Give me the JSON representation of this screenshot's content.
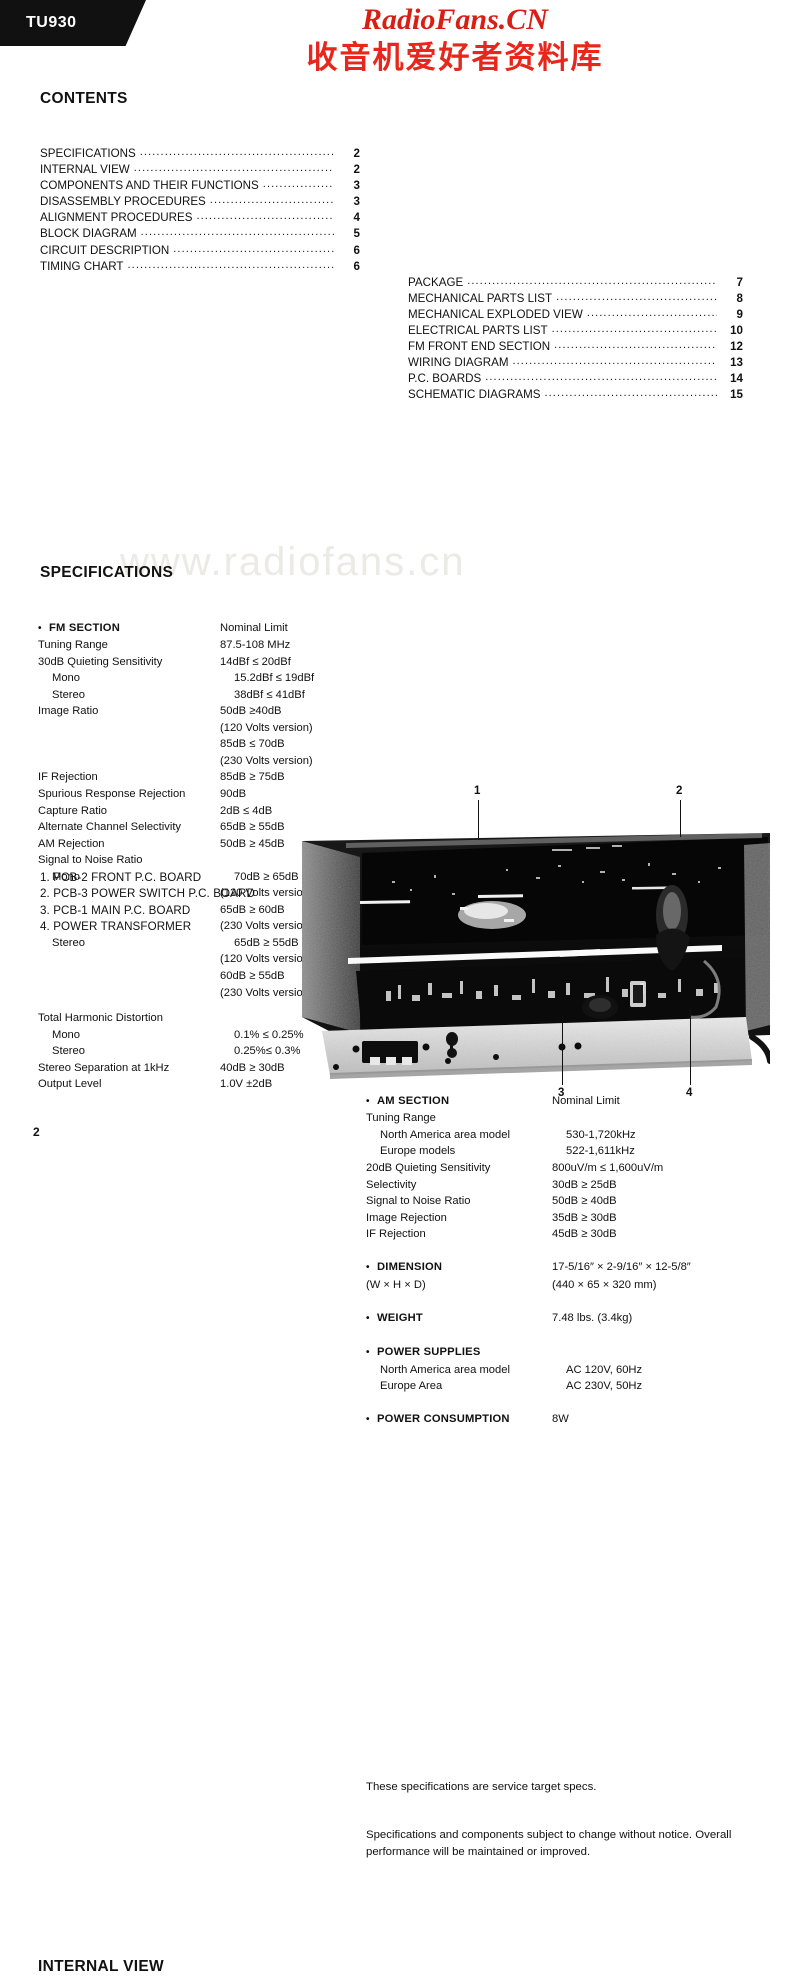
{
  "header": {
    "model": "TU930",
    "brand_latin": "RadioFans.CN",
    "brand_cjk": "收音机爱好者资料库",
    "brand_color": "#d81f16"
  },
  "watermark": "www.radiofans.cn",
  "page_number": "2",
  "contents": {
    "heading": "CONTENTS",
    "left": [
      {
        "label": "SPECIFICATIONS",
        "page": "2"
      },
      {
        "label": "INTERNAL VIEW",
        "page": "2"
      },
      {
        "label": "COMPONENTS AND THEIR FUNCTIONS",
        "page": "3"
      },
      {
        "label": "DISASSEMBLY PROCEDURES",
        "page": "3"
      },
      {
        "label": "ALIGNMENT PROCEDURES",
        "page": "4"
      },
      {
        "label": "BLOCK DIAGRAM",
        "page": "5"
      },
      {
        "label": "CIRCUIT DESCRIPTION",
        "page": "6"
      },
      {
        "label": "TIMING CHART",
        "page": "6"
      }
    ],
    "right": [
      {
        "label": "PACKAGE",
        "page": "7"
      },
      {
        "label": "MECHANICAL PARTS LIST",
        "page": "8"
      },
      {
        "label": "MECHANICAL EXPLODED VIEW",
        "page": "9"
      },
      {
        "label": "ELECTRICAL PARTS LIST",
        "page": "10"
      },
      {
        "label": "FM FRONT END SECTION",
        "page": "12"
      },
      {
        "label": "WIRING DIAGRAM",
        "page": "13"
      },
      {
        "label": "P.C. BOARDS",
        "page": "14"
      },
      {
        "label": "SCHEMATIC DIAGRAMS",
        "page": "15"
      }
    ]
  },
  "specifications": {
    "heading": "SPECIFICATIONS",
    "fm": {
      "title": "FM SECTION",
      "column_header": "Nominal Limit",
      "rows": [
        {
          "name": "Tuning Range",
          "value": "87.5-108 MHz"
        },
        {
          "name": "30dB Quieting Sensitivity",
          "value": "14dBf ≤ 20dBf"
        },
        {
          "name": "Mono",
          "value": "15.2dBf ≤ 19dBf",
          "indent": 1
        },
        {
          "name": "Stereo",
          "value": "38dBf ≤ 41dBf",
          "indent": 1
        },
        {
          "name": "Image Ratio",
          "value": "50dB ≥40dB"
        },
        {
          "name": "",
          "value": "(120 Volts version)"
        },
        {
          "name": "",
          "value": "85dB ≤ 70dB"
        },
        {
          "name": "",
          "value": "(230 Volts version)"
        },
        {
          "name": "IF Rejection",
          "value": "85dB ≥ 75dB"
        },
        {
          "name": "Spurious Response Rejection",
          "value": "90dB"
        },
        {
          "name": "Capture Ratio",
          "value": "2dB ≤ 4dB"
        },
        {
          "name": "Alternate Channel Selectivity",
          "value": "65dB ≥ 55dB"
        },
        {
          "name": "AM Rejection",
          "value": "50dB ≥ 45dB"
        },
        {
          "name": "Signal to Noise Ratio",
          "value": ""
        },
        {
          "name": "Mono",
          "value": "70dB ≥ 65dB",
          "indent": 1
        },
        {
          "name": "",
          "value": "(120 Volts version)"
        },
        {
          "name": "",
          "value": "65dB ≥ 60dB"
        },
        {
          "name": "",
          "value": "(230 Volts version)"
        },
        {
          "name": "Stereo",
          "value": "65dB ≥ 55dB",
          "indent": 1
        },
        {
          "name": "",
          "value": "(120 Volts version)"
        },
        {
          "name": "",
          "value": "60dB ≥ 55dB"
        },
        {
          "name": "",
          "value": "(230 Volts version)"
        },
        {
          "name": "",
          "value": "",
          "spacer": true
        },
        {
          "name": "Total Harmonic Distortion",
          "value": ""
        },
        {
          "name": "Mono",
          "value": "0.1% ≤ 0.25%",
          "indent": 1
        },
        {
          "name": "Stereo",
          "value": "0.25%≤ 0.3%",
          "indent": 1
        },
        {
          "name": "Stereo Separation at 1kHz",
          "value": "40dB ≥ 30dB"
        },
        {
          "name": "Output Level",
          "value": "1.0V ±2dB"
        }
      ]
    },
    "am": {
      "title": "AM SECTION",
      "column_header": "Nominal Limit",
      "rows": [
        {
          "name": "Tuning Range",
          "value": ""
        },
        {
          "name": "North America area model",
          "value": "530-1,720kHz",
          "indent": 1
        },
        {
          "name": "Europe models",
          "value": "522-1,611kHz",
          "indent": 1
        },
        {
          "name": "20dB Quieting Sensitivity",
          "value": "800uV/m ≤ 1,600uV/m"
        },
        {
          "name": "Selectivity",
          "value": "30dB ≥ 25dB"
        },
        {
          "name": "Signal to Noise Ratio",
          "value": "50dB ≥ 40dB"
        },
        {
          "name": "Image Rejection",
          "value": "35dB ≥ 30dB"
        },
        {
          "name": "IF Rejection",
          "value": "45dB ≥ 30dB"
        }
      ]
    },
    "dimension": {
      "title": "DIMENSION",
      "value": "17-5/16″ × 2-9/16″ × 12-5/8″",
      "sub_label": "(W × H × D)",
      "sub_value": "(440 × 65 × 320 mm)"
    },
    "weight": {
      "title": "WEIGHT",
      "value": "7.48 lbs. (3.4kg)"
    },
    "power_supplies": {
      "title": "POWER SUPPLIES",
      "rows": [
        {
          "name": "North America area model",
          "value": "AC 120V, 60Hz"
        },
        {
          "name": "Europe Area",
          "value": "AC 230V, 50Hz"
        }
      ]
    },
    "power_consumption": {
      "title": "POWER CONSUMPTION",
      "value": "8W"
    },
    "note_1": "These specifications are service target specs.",
    "note_2": "Specifications and components subject to change without notice. Overall performance will be maintained or improved."
  },
  "internal_view": {
    "heading": "INTERNAL VIEW",
    "items": [
      "1. PCB-2 FRONT P.C. BOARD",
      "2. PCB-3 POWER SWITCH P.C. BOARD",
      "3. PCB-1 MAIN P.C. BOARD",
      "4. POWER TRANSFORMER"
    ],
    "callouts": [
      {
        "label": "1",
        "position": "top"
      },
      {
        "label": "2",
        "position": "top"
      },
      {
        "label": "3",
        "position": "bottom"
      },
      {
        "label": "4",
        "position": "bottom"
      }
    ]
  }
}
